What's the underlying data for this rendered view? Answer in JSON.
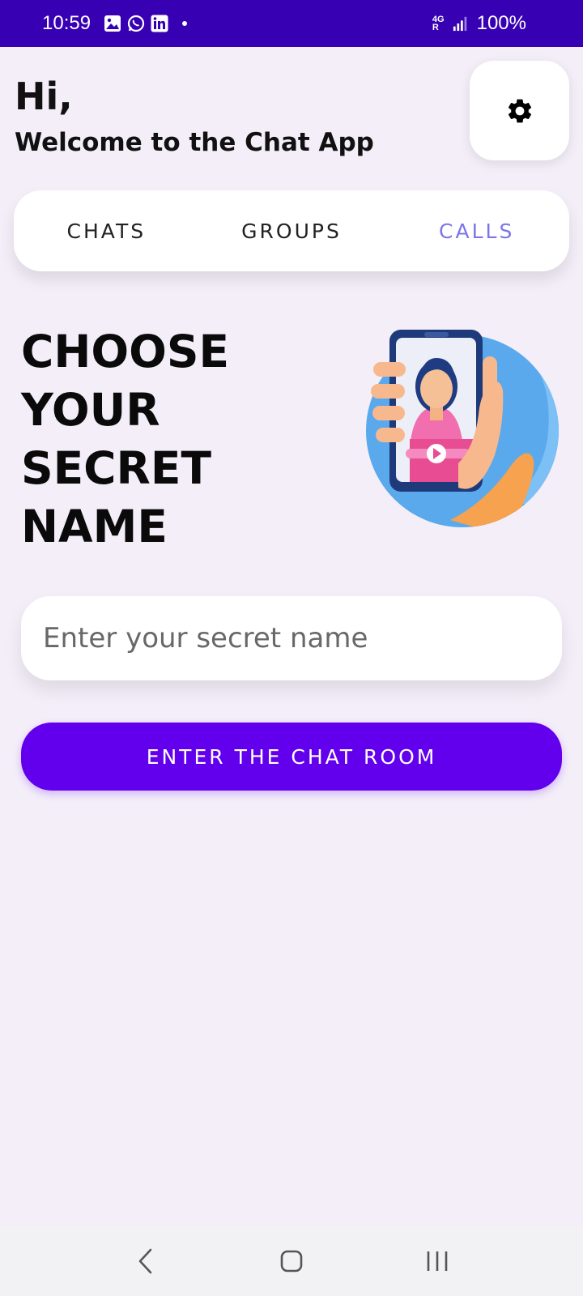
{
  "status_bar": {
    "time": "10:59",
    "network": [
      "4G",
      "R"
    ],
    "battery": "100%",
    "icons": [
      "gallery-icon",
      "whatsapp-icon",
      "linkedin-icon",
      "notification-dot",
      "signal-icon"
    ]
  },
  "header": {
    "greeting": "Hi,",
    "welcome": "Welcome to the Chat App",
    "settings_icon": "gear-icon"
  },
  "tabs": [
    {
      "label": "CHATS",
      "active": false
    },
    {
      "label": "GROUPS",
      "active": false
    },
    {
      "label": "CALLS",
      "active": true
    }
  ],
  "main": {
    "headline_lines": [
      "CHOOSE",
      "YOUR",
      "SECRET",
      "NAME"
    ],
    "illustration": "video-call-illustration",
    "input_placeholder": "Enter your secret name",
    "input_value": "",
    "button_label": "ENTER THE CHAT ROOM"
  },
  "nav_bar": {
    "items": [
      "back-icon",
      "home-icon",
      "recents-icon"
    ]
  },
  "colors": {
    "status_bar": "#3700b3",
    "background": "#f4eef9",
    "primary_button": "#6200ee",
    "active_tab": "#7c75e8"
  }
}
